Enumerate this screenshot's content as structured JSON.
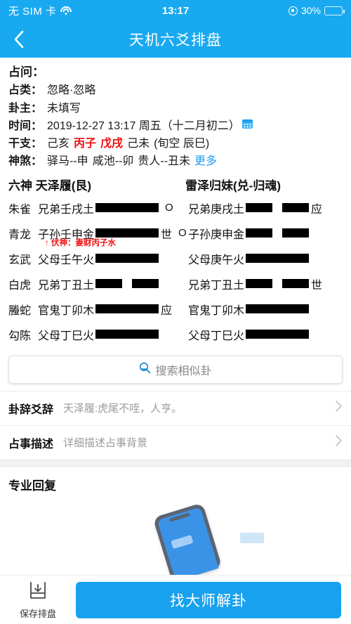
{
  "statusbar": {
    "carrier": "无 SIM 卡",
    "wifi_icon": "wifi-icon",
    "time": "13:17",
    "rotation_lock_icon": "rotation-lock-icon",
    "battery_percent": "30%",
    "battery_level": 30
  },
  "navbar": {
    "back_icon": "back-chevron-icon",
    "title": "天机六爻排盘"
  },
  "info": {
    "title": "占问：",
    "rows": [
      {
        "label": "占类：",
        "value": "忽略·忽略"
      },
      {
        "label": "卦主：",
        "value": "未填写"
      }
    ],
    "time_row": {
      "label": "时间：",
      "value": "2019-12-27 13:17 周五（十二月初二）",
      "calendar_icon": "calendar-icon"
    },
    "ganzhi_row": {
      "label": "干支：",
      "seg1": "己亥",
      "seg2_red": "丙子",
      "seg3_red": "戊戌",
      "seg4": "己未",
      "seg5": "(旬空 辰巳)"
    },
    "shensha_row": {
      "label": "神煞：",
      "items": [
        "驿马--申",
        "咸池--卯",
        "贵人--丑未"
      ],
      "more_label": "更多"
    }
  },
  "hexagram": {
    "header_sixgod": "六神",
    "header_left": "天泽履(艮)",
    "header_right": "雷泽归妹(兑-归魂)",
    "rows": [
      {
        "sixgod": "朱雀",
        "left_name": "兄弟壬戌土",
        "left_type": "yang",
        "left_mark": "",
        "left_moving": "O",
        "right_name": "兄弟庚戌土",
        "right_type": "yin",
        "right_mark": "应"
      },
      {
        "sixgod": "青龙",
        "left_name": "子孙壬申金",
        "left_type": "yang",
        "left_mark": "世",
        "left_moving": "O",
        "right_name": "子孙庚申金",
        "right_type": "yin",
        "right_mark": "",
        "fushen": "↑ 伏神：妻财丙子水"
      },
      {
        "sixgod": "玄武",
        "left_name": "父母壬午火",
        "left_type": "yang",
        "left_mark": "",
        "left_moving": "",
        "right_name": "父母庚午火",
        "right_type": "yang",
        "right_mark": ""
      },
      {
        "sixgod": "白虎",
        "left_name": "兄弟丁丑土",
        "left_type": "yin",
        "left_mark": "",
        "left_moving": "",
        "right_name": "兄弟丁丑土",
        "right_type": "yin",
        "right_mark": "世"
      },
      {
        "sixgod": "螣蛇",
        "left_name": "官鬼丁卯木",
        "left_type": "yang",
        "left_mark": "应",
        "left_moving": "",
        "right_name": "官鬼丁卯木",
        "right_type": "yang",
        "right_mark": ""
      },
      {
        "sixgod": "勾陈",
        "left_name": "父母丁巳火",
        "left_type": "yang",
        "left_mark": "",
        "left_moving": "",
        "right_name": "父母丁巳火",
        "right_type": "yang",
        "right_mark": ""
      }
    ]
  },
  "search": {
    "icon": "search-icon",
    "placeholder": "搜索相似卦"
  },
  "list_rows": [
    {
      "name": "卦辞爻辞",
      "value": "天泽履:虎尾不咥，人亨。",
      "chevron": "chevron-right-icon"
    },
    {
      "name": "占事描述",
      "value": "详细描述占事背景",
      "chevron": "chevron-right-icon"
    }
  ],
  "pro_section": {
    "title": "专业回复"
  },
  "bottombar": {
    "save_icon": "save-download-icon",
    "save_label": "保存排盘",
    "master_label": "找大师解卦"
  },
  "colors": {
    "accent_blue": "#18a9f0",
    "button_blue": "#18a1ef",
    "link_blue": "#1d9ef0",
    "red": "#ee1111",
    "muted_gray": "#9a9a9a"
  }
}
